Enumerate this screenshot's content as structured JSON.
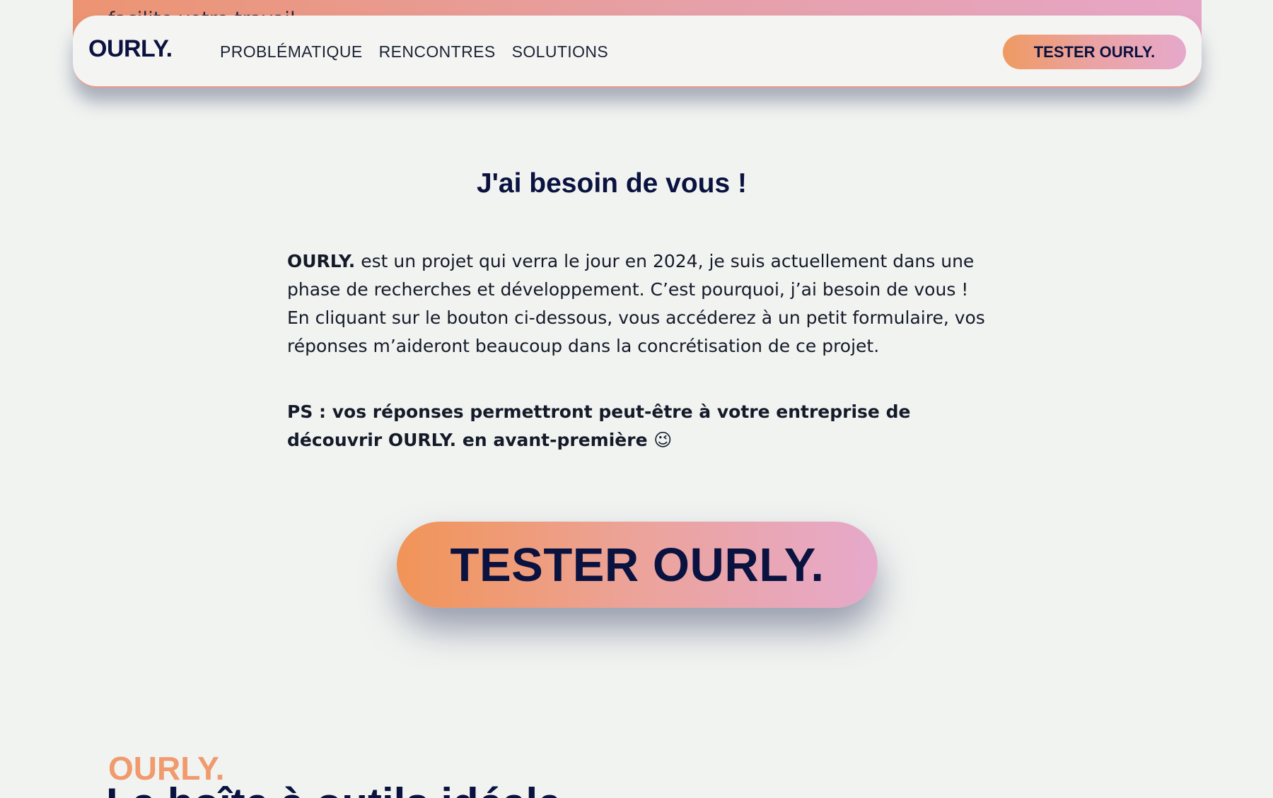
{
  "top_strip": {
    "text": "facilite votre travail"
  },
  "navbar": {
    "logo": "OURLY.",
    "links": [
      "PROBLÉMATIQUE",
      "RENCONTRES",
      "SOLUTIONS"
    ],
    "cta_label": "TESTER OURLY."
  },
  "main": {
    "headline": "J'ai besoin de vous !",
    "body_lead": "OURLY.",
    "body_text_1": " est un projet qui verra le jour en 2024, je suis actuellement dans une phase de recherches et développement. C’est pourquoi, j’ai besoin de vous !",
    "body_text_2": "En cliquant sur le bouton ci-dessous, vous accéderez à un petit formulaire, vos réponses m’aideront beaucoup dans la concrétisation de ce projet.",
    "ps_text": "PS : vos réponses permettront peut-être à votre entreprise de découvrir OURLY. en avant-première 😉",
    "cta_label": "TESTER OURLY."
  },
  "bottom": {
    "logo": "OURLY.",
    "heading": "La boîte à outils idéale"
  },
  "colors": {
    "background": "#f1f3f1",
    "navy": "#0a1240",
    "gradient_start": "#f19457",
    "gradient_end": "#e6a9cb",
    "accent_orange": "#f09a6e"
  }
}
